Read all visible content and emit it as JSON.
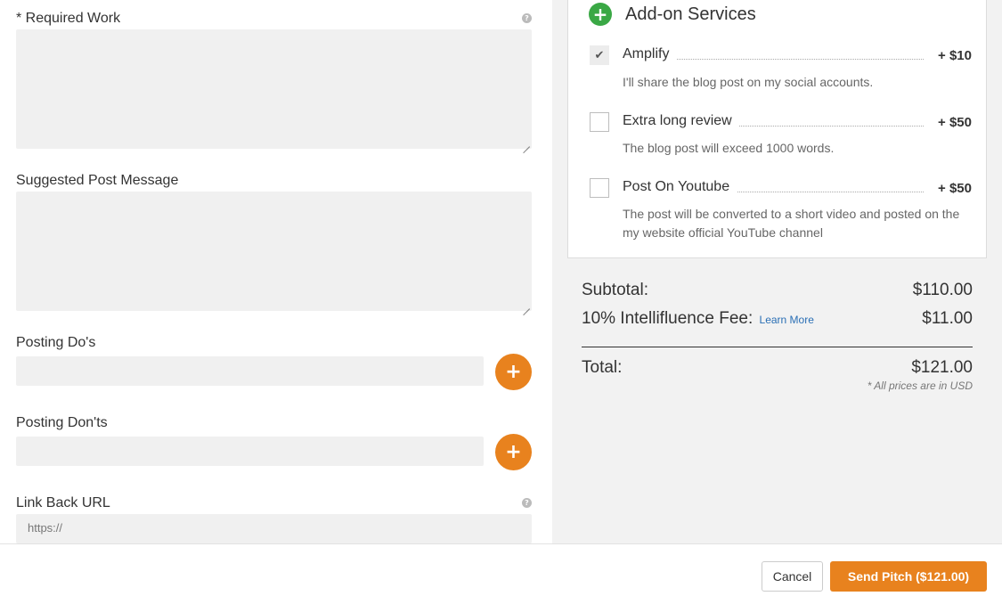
{
  "form": {
    "required_work_label": "* Required Work",
    "suggested_post_label": "Suggested Post Message",
    "posting_dos_label": "Posting Do's",
    "posting_donts_label": "Posting Don'ts",
    "link_back_label": "Link Back URL",
    "link_back_placeholder": "https://",
    "help_glyph": "?",
    "plus_glyph": "+"
  },
  "addons": {
    "title": "Add-on Services",
    "head_icon_glyph": "+",
    "items": [
      {
        "name": "Amplify",
        "price": "+ $10",
        "description": "I'll share the blog post on my social accounts.",
        "checked": true,
        "check_glyph": "✔"
      },
      {
        "name": "Extra long review",
        "price": "+ $50",
        "description": "The blog post will exceed 1000 words.",
        "checked": false,
        "check_glyph": ""
      },
      {
        "name": "Post On Youtube",
        "price": "+ $50",
        "description": "The post will be converted to a short video and posted on the my website official YouTube channel",
        "checked": false,
        "check_glyph": ""
      }
    ]
  },
  "summary": {
    "subtotal_label": "Subtotal:",
    "subtotal_value": "$110.00",
    "fee_label": "10% Intellifluence Fee:",
    "fee_link": "Learn More",
    "fee_value": "$11.00",
    "total_label": "Total:",
    "total_value": "$121.00",
    "currency_note": "* All prices are in USD"
  },
  "footer": {
    "cancel_label": "Cancel",
    "send_label": "Send Pitch ($121.00)"
  },
  "colors": {
    "accent_orange": "#e8821e",
    "addon_green": "#3aa845",
    "link_blue": "#2a6fb5",
    "field_bg": "#f0f0f0"
  }
}
